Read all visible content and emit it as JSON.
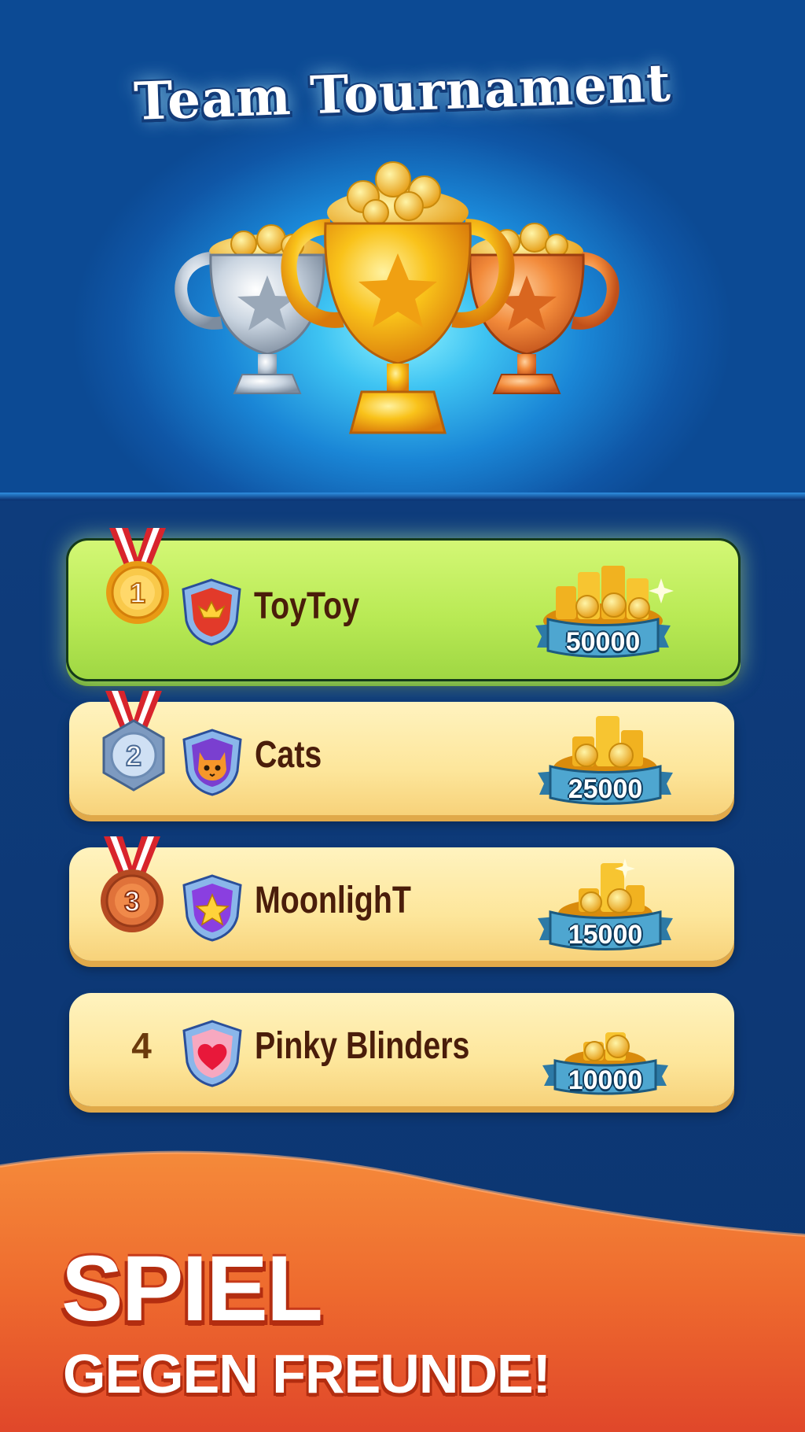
{
  "header": {
    "title": "Team Tournament"
  },
  "leaderboard": [
    {
      "rank": "1",
      "team": "ToyToy",
      "team_icon": "crown-icon",
      "reward": "50000",
      "medal": "gold-medal-icon"
    },
    {
      "rank": "2",
      "team": "Cats",
      "team_icon": "cat-icon",
      "reward": "25000",
      "medal": "silver-medal-icon"
    },
    {
      "rank": "3",
      "team": "MoonlighT",
      "team_icon": "star-icon",
      "reward": "15000",
      "medal": "bronze-medal-icon"
    },
    {
      "rank": "4",
      "team": "Pinky Blinders",
      "team_icon": "heart-icon",
      "reward": "10000"
    }
  ],
  "promo": {
    "line1": "SPIEL",
    "line2": "GEGEN FREUNDE!"
  },
  "colors": {
    "sky": "#1a86d6",
    "navy": "#0d3a7a",
    "row_first": "#b9ea55",
    "row": "#fde69b",
    "team_text": "#4a1d0a",
    "banner_blue": "#3f9ac4",
    "promo_orange": "#e8532b"
  }
}
